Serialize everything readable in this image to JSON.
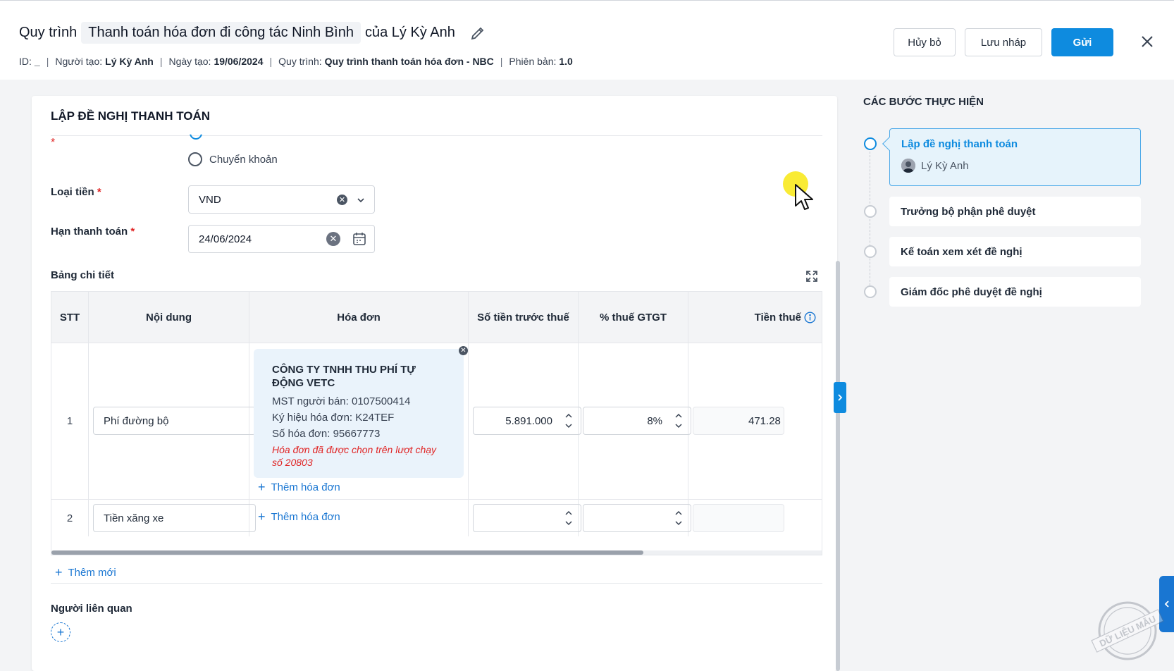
{
  "header": {
    "prefix": "Quy trình",
    "process_name": "Thanh toán hóa đơn đi công tác Ninh Bình",
    "suffix": "của Lý Kỳ Anh",
    "meta": {
      "id_label": "ID:",
      "id_value": "_",
      "creator_label": "Người tạo:",
      "creator_value": "Lý Kỳ Anh",
      "date_label": "Ngày tạo:",
      "date_value": "19/06/2024",
      "process_label": "Quy trình:",
      "process_value": "Quy trình thanh toán hóa đơn - NBC",
      "version_label": "Phiên bản:",
      "version_value": "1.0"
    },
    "buttons": {
      "cancel": "Hủy bỏ",
      "draft": "Lưu nháp",
      "send": "Gửi"
    }
  },
  "form": {
    "title": "LẬP ĐỀ NGHỊ THANH TOÁN",
    "payment_option": "Chuyển khoản",
    "currency_label": "Loại tiền",
    "currency_value": "VND",
    "due_label": "Hạn thanh toán",
    "due_value": "24/06/2024",
    "table_label": "Bảng chi tiết",
    "add_new": "Thêm mới",
    "related_label": "Người liên quan",
    "required_mark": "*"
  },
  "table": {
    "headers": [
      "STT",
      "Nội dung",
      "Hóa đơn",
      "Số tiền trước thuế",
      "% thuế GTGT",
      "Tiền thuế"
    ],
    "add_invoice": "Thêm hóa đơn",
    "rows": [
      {
        "stt": "1",
        "content": "Phí đường bộ",
        "invoice": {
          "company": "CÔNG TY TNHH THU PHÍ TỰ ĐỘNG VETC",
          "tax_code": "MST người bán: 0107500414",
          "symbol": "Ký hiệu hóa đơn: K24TEF",
          "number": "Số hóa đơn: 95667773",
          "warning": "Hóa đơn đã được chọn trên lượt chạy số 20803"
        },
        "amount": "5.891.000",
        "vat": "8%",
        "tax": "471.28"
      },
      {
        "stt": "2",
        "content": "Tiền xăng xe",
        "amount": "",
        "vat": "",
        "tax": ""
      }
    ]
  },
  "steps": {
    "title": "CÁC BƯỚC THỰC HIỆN",
    "items": [
      {
        "label": "Lập đề nghị thanh toán",
        "user": "Lý Kỳ Anh",
        "active": true
      },
      {
        "label": "Trưởng bộ phận phê duyệt"
      },
      {
        "label": "Kế toán xem xét đề nghị"
      },
      {
        "label": "Giám đốc phê duyệt đề nghị"
      }
    ]
  },
  "watermark_text": "DỮ LIỆU MẪU",
  "colors": {
    "primary": "#0e8bdf",
    "link": "#1976d2",
    "required": "#e02424"
  }
}
